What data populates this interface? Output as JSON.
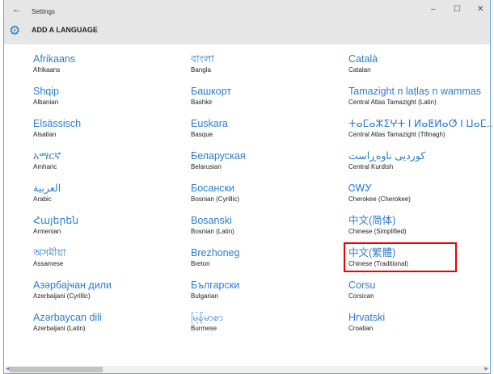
{
  "window": {
    "title": "Settings",
    "page_title": "ADD A LANGUAGE",
    "colors": {
      "accent": "#2b7cd3",
      "titlebar": "#e6e6e6",
      "highlight": "#e00000"
    }
  },
  "columns": [
    [
      {
        "native": "Afrikaans",
        "english": "Afrikaans"
      },
      {
        "native": "Shqip",
        "english": "Albanian"
      },
      {
        "native": "Elsässisch",
        "english": "Alsatian"
      },
      {
        "native": "አማርኛ",
        "english": "Amharic"
      },
      {
        "native": "العربية",
        "english": "Arabic"
      },
      {
        "native": "Հայերեն",
        "english": "Armenian"
      },
      {
        "native": "অসমীয়া",
        "english": "Assamese"
      },
      {
        "native": "Азәрбајҹан дили",
        "english": "Azerbaijani (Cyrillic)"
      },
      {
        "native": "Azərbaycan dili",
        "english": "Azerbaijani (Latin)"
      }
    ],
    [
      {
        "native": "বাংলা",
        "english": "Bangla"
      },
      {
        "native": "Башкорт",
        "english": "Bashkir"
      },
      {
        "native": "Euskara",
        "english": "Basque"
      },
      {
        "native": "Беларуская",
        "english": "Belarusian"
      },
      {
        "native": "Босански",
        "english": "Bosnian (Cyrillic)"
      },
      {
        "native": "Bosanski",
        "english": "Bosnian (Latin)"
      },
      {
        "native": "Brezhoneg",
        "english": "Breton"
      },
      {
        "native": "Български",
        "english": "Bulgarian"
      },
      {
        "native": "မြန်မာစာ",
        "english": "Burmese"
      }
    ],
    [
      {
        "native": "Català",
        "english": "Catalan"
      },
      {
        "native": "Tamazight n laṭlaṣ n wammas",
        "english": "Central Atlas Tamazight (Latin)"
      },
      {
        "native": "ⵜⴰⵎⴰⵣⵉⵖⵜ ⵏ ⵍⴰⵟⵍⴰⵚ ⵏ ⵡⴰⵎⵎⴰⵙ",
        "english": "Central Atlas Tamazight (Tifinagh)"
      },
      {
        "native": "کوردیی ناوەڕاست",
        "english": "Central Kurdish"
      },
      {
        "native": "ᏣᎳᎩ",
        "english": "Cherokee (Cherokee)"
      },
      {
        "native": "中文(简体)",
        "english": "Chinese (Simplified)"
      },
      {
        "native": "中文(繁體)",
        "english": "Chinese (Traditional)"
      },
      {
        "native": "Corsu",
        "english": "Corsican"
      },
      {
        "native": "Hrvatski",
        "english": "Croatian"
      }
    ]
  ]
}
